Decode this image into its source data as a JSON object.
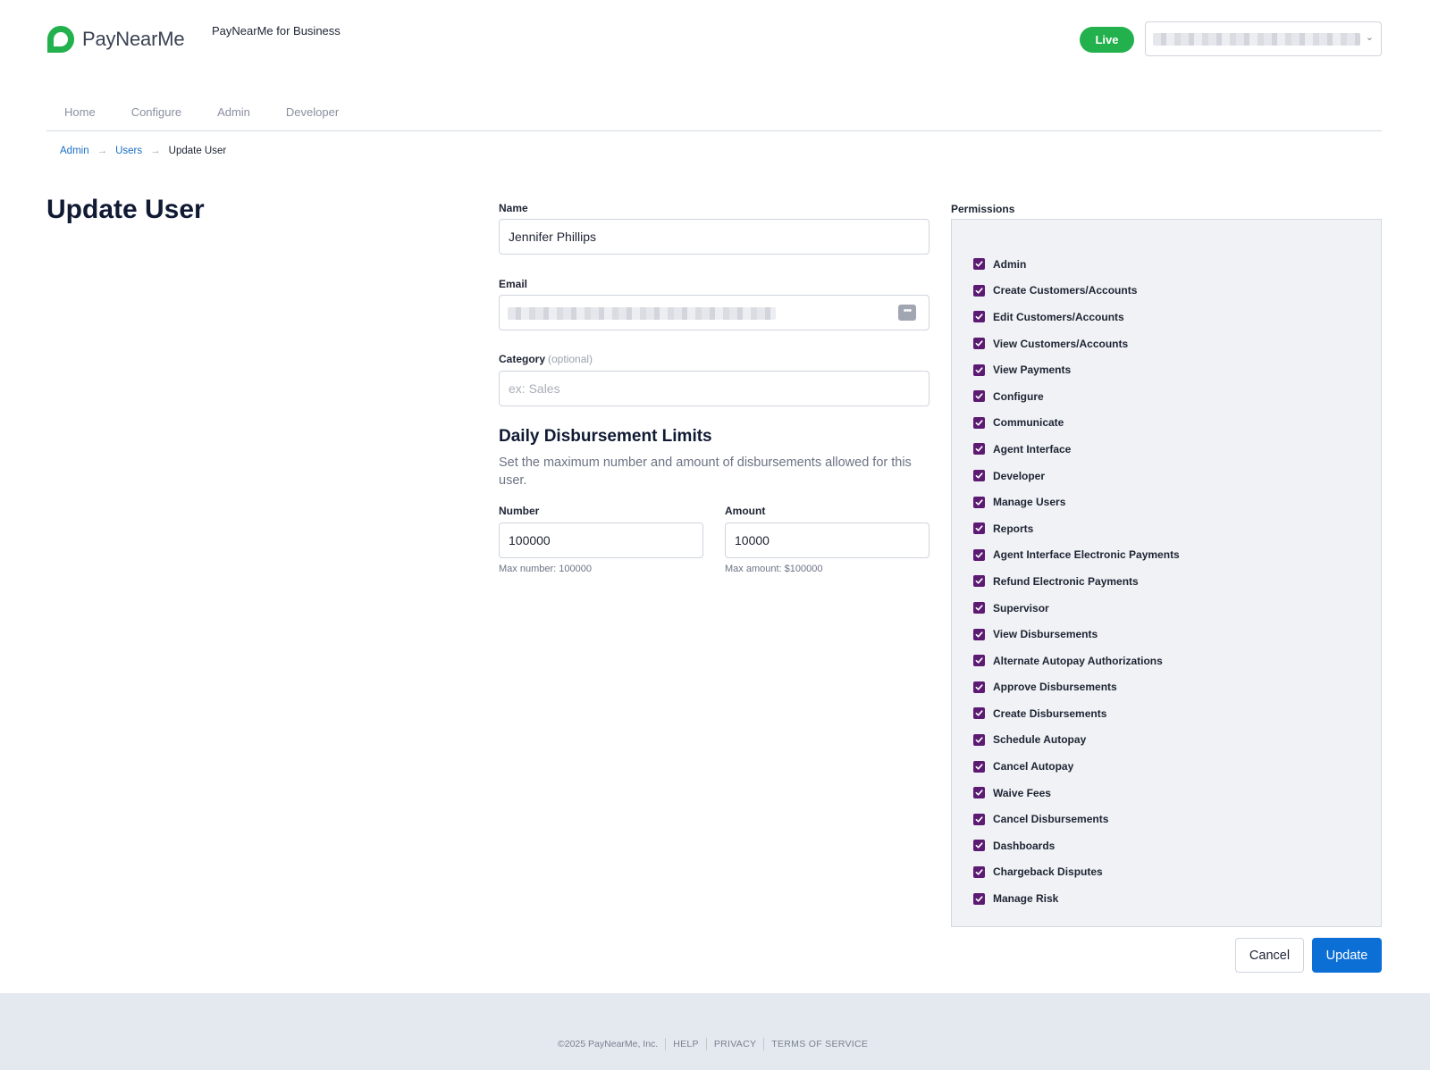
{
  "brand": {
    "logo_text": "PayNearMe",
    "business_label": "PayNearMe for Business",
    "brand_color": "#22b14c"
  },
  "header": {
    "live_label": "Live",
    "account_icon": "chevron-down-icon"
  },
  "nav": {
    "items": [
      {
        "label": "Home"
      },
      {
        "label": "Configure"
      },
      {
        "label": "Admin"
      },
      {
        "label": "Developer"
      }
    ]
  },
  "breadcrumb": {
    "items": [
      {
        "label": "Admin"
      },
      {
        "label": "Users"
      }
    ],
    "separator": "→",
    "current": "Update User"
  },
  "page": {
    "title": "Update User"
  },
  "form": {
    "name": {
      "label": "Name",
      "value": "Jennifer Phillips"
    },
    "email": {
      "label": "Email",
      "icon": "more-dots-icon"
    },
    "category": {
      "label": "Category",
      "optional_label": "(optional)",
      "placeholder": "ex: Sales",
      "value": ""
    },
    "limits": {
      "title": "Daily Disbursement Limits",
      "description": "Set the maximum number and amount of disbursements allowed for this user.",
      "number": {
        "label": "Number",
        "value": "100000",
        "hint": "Max number: 100000"
      },
      "amount": {
        "label": "Amount",
        "value": "10000",
        "hint": "Max amount: $100000"
      }
    }
  },
  "permissions": {
    "label": "Permissions",
    "checkbox_color": "#5c1a72",
    "items": [
      {
        "label": "Admin",
        "checked": true
      },
      {
        "label": "Create Customers/Accounts",
        "checked": true
      },
      {
        "label": "Edit Customers/Accounts",
        "checked": true
      },
      {
        "label": "View Customers/Accounts",
        "checked": true
      },
      {
        "label": "View Payments",
        "checked": true
      },
      {
        "label": "Configure",
        "checked": true
      },
      {
        "label": "Communicate",
        "checked": true
      },
      {
        "label": "Agent Interface",
        "checked": true
      },
      {
        "label": "Developer",
        "checked": true
      },
      {
        "label": "Manage Users",
        "checked": true
      },
      {
        "label": "Reports",
        "checked": true
      },
      {
        "label": "Agent Interface Electronic Payments",
        "checked": true
      },
      {
        "label": "Refund Electronic Payments",
        "checked": true
      },
      {
        "label": "Supervisor",
        "checked": true
      },
      {
        "label": "View Disbursements",
        "checked": true
      },
      {
        "label": "Alternate Autopay Authorizations",
        "checked": true
      },
      {
        "label": "Approve Disbursements",
        "checked": true
      },
      {
        "label": "Create Disbursements",
        "checked": true
      },
      {
        "label": "Schedule Autopay",
        "checked": true
      },
      {
        "label": "Cancel Autopay",
        "checked": true
      },
      {
        "label": "Waive Fees",
        "checked": true
      },
      {
        "label": "Cancel Disbursements",
        "checked": true
      },
      {
        "label": "Dashboards",
        "checked": true
      },
      {
        "label": "Chargeback Disputes",
        "checked": true
      },
      {
        "label": "Manage Risk",
        "checked": true
      }
    ]
  },
  "actions": {
    "cancel_label": "Cancel",
    "update_label": "Update",
    "primary_color": "#0b6fd6"
  },
  "footer": {
    "copyright": "©2025 PayNearMe, Inc.",
    "links": [
      {
        "label": "HELP"
      },
      {
        "label": "PRIVACY"
      },
      {
        "label": "TERMS OF SERVICE"
      }
    ]
  }
}
